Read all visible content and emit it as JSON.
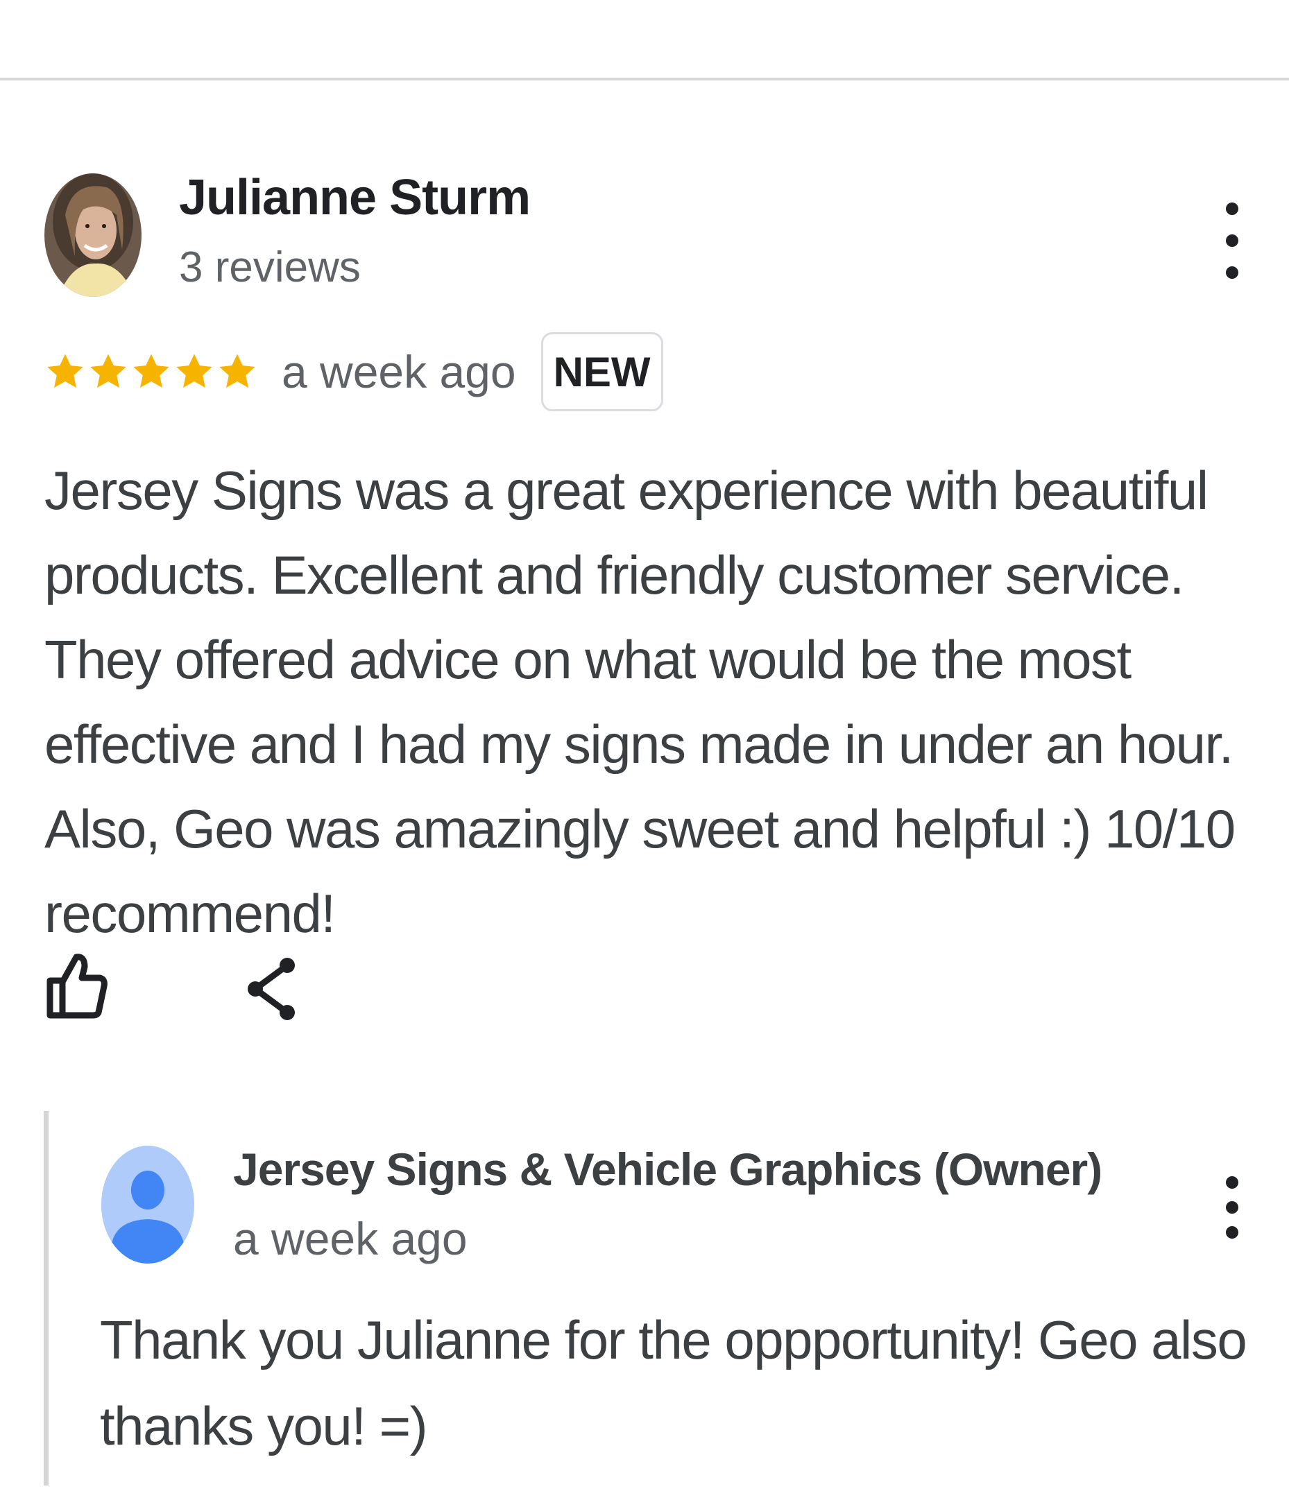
{
  "review": {
    "author_name": "Julianne Sturm",
    "author_meta": "3 reviews",
    "avatar_icon": "user-photo",
    "rating": 5,
    "rating_max": 5,
    "star_color": "#f6b400",
    "time": "a week ago",
    "badge": "NEW",
    "text": "Jersey Signs was a great experience with beautiful products. Excellent and friendly customer service. They offered advice on what would be the most effective and I had my signs made in under an hour. Also, Geo was amazingly sweet and helpful :) 10/10 recommend!",
    "more_icon": "more-vert-icon",
    "actions": {
      "like_icon": "thumb-up-icon",
      "share_icon": "share-icon"
    }
  },
  "reply": {
    "owner_name": "Jersey Signs & Vehicle Graphics (Owner)",
    "time": "a week ago",
    "text": "Thank you Julianne for the oppportunity! Geo also thanks you! =)",
    "avatar_icon": "default-user-icon",
    "avatar_color": "#aecbfa",
    "avatar_figure_color": "#4285f4",
    "more_icon": "more-vert-icon"
  }
}
